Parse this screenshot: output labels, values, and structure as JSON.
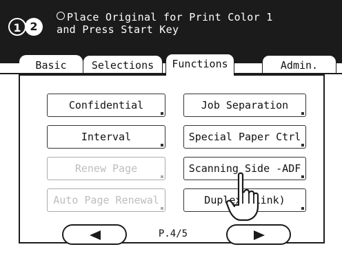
{
  "header": {
    "badge_one": "1",
    "badge_two": "2",
    "message_line1": "Place Original for Print Color 1",
    "message_line2": "and Press Start Key"
  },
  "tabs": [
    {
      "label": "Basic",
      "active": false
    },
    {
      "label": "Selections",
      "active": false
    },
    {
      "label": "Functions",
      "active": true
    },
    {
      "label": "Admin.",
      "active": false
    }
  ],
  "functions": {
    "left": [
      {
        "label": "Confidential",
        "enabled": true
      },
      {
        "label": "Interval",
        "enabled": true
      },
      {
        "label": "Renew Page",
        "enabled": false
      },
      {
        "label": "Auto Page Renewal",
        "enabled": false
      }
    ],
    "right": [
      {
        "label": "Job Separation",
        "enabled": true
      },
      {
        "label": "Special Paper Ctrl",
        "enabled": true
      },
      {
        "label": "Scanning Side -ADF",
        "enabled": true
      },
      {
        "label": "Duplex (Link)",
        "enabled": true
      }
    ]
  },
  "pager": {
    "prev_icon": "left-triangle-icon",
    "next_icon": "right-triangle-icon",
    "indicator": "P.4/5"
  },
  "overlay": {
    "icon": "hand-pointer-icon"
  }
}
